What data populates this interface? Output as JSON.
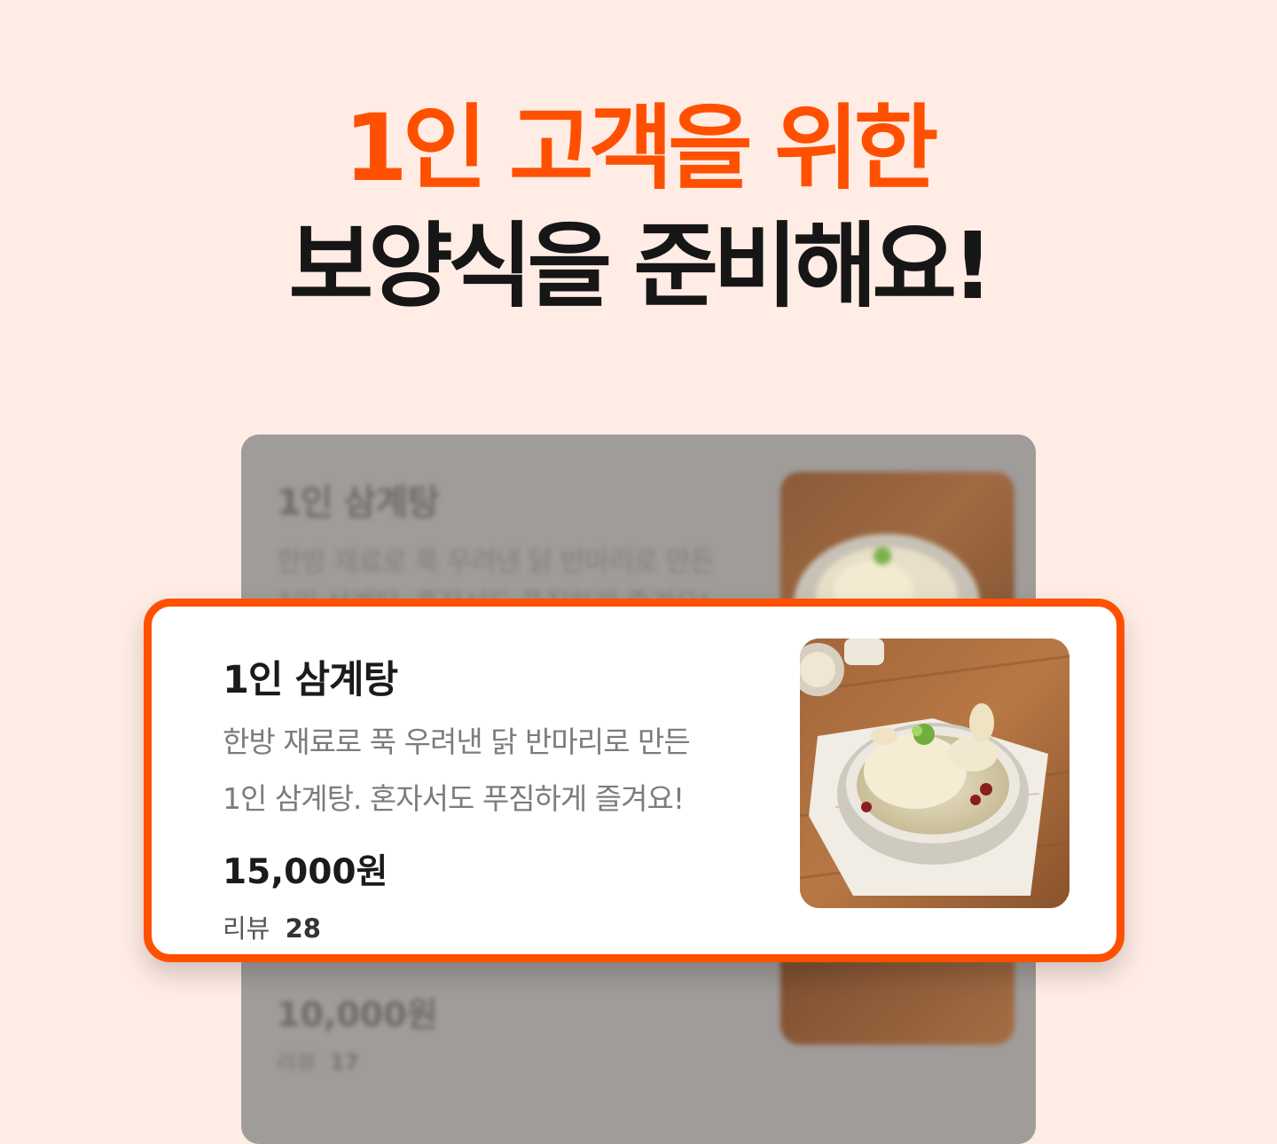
{
  "hero": {
    "line1": "1인 고객을 위한",
    "line2": "보양식을 준비해요!",
    "accent_color": "#FF5000"
  },
  "background_card": {
    "title": "1인 삼계탕",
    "desc_line1": "한방 재료로 푹 우려낸 닭 반마리로 만든",
    "desc_line2": "1인 삼계탕. 혼자서도 푸짐하게 즐겨요!",
    "price": "10,000원",
    "review_label": "리뷰",
    "review_count": "17"
  },
  "menu_card": {
    "title": "1인 삼계탕",
    "desc_line1": "한방 재료로 푹 우려낸 닭 반마리로 만든",
    "desc_line2": "1인 삼계탕. 혼자서도 푸짐하게 즐겨요!",
    "price": "15,000원",
    "review_label": "리뷰",
    "review_count": "28",
    "image": "samgyetang-photo"
  }
}
